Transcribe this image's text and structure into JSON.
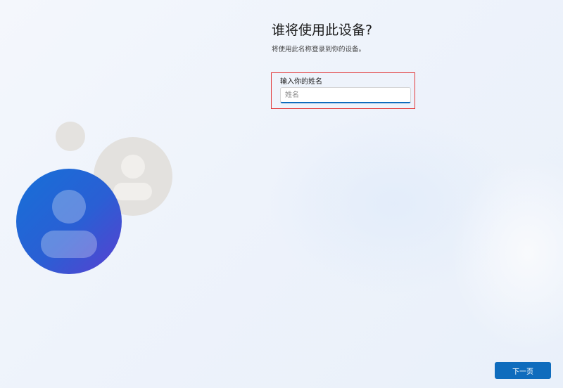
{
  "page": {
    "title": "谁将使用此设备?",
    "subtitle": "将使用此名称登录到你的设备。"
  },
  "name_field": {
    "label": "输入你的姓名",
    "placeholder": "姓名",
    "value": ""
  },
  "actions": {
    "next_label": "下一页"
  },
  "illustration": {
    "icons": [
      "user-avatar-icon",
      "user-avatar-icon",
      "small-circle-icon"
    ]
  },
  "colors": {
    "accent": "#0f6cbd",
    "highlight": "#e23a3a",
    "avatar_primary_from": "#1a6fd6",
    "avatar_primary_to": "#5a3fd0",
    "avatar_secondary": "#e3e1de"
  }
}
